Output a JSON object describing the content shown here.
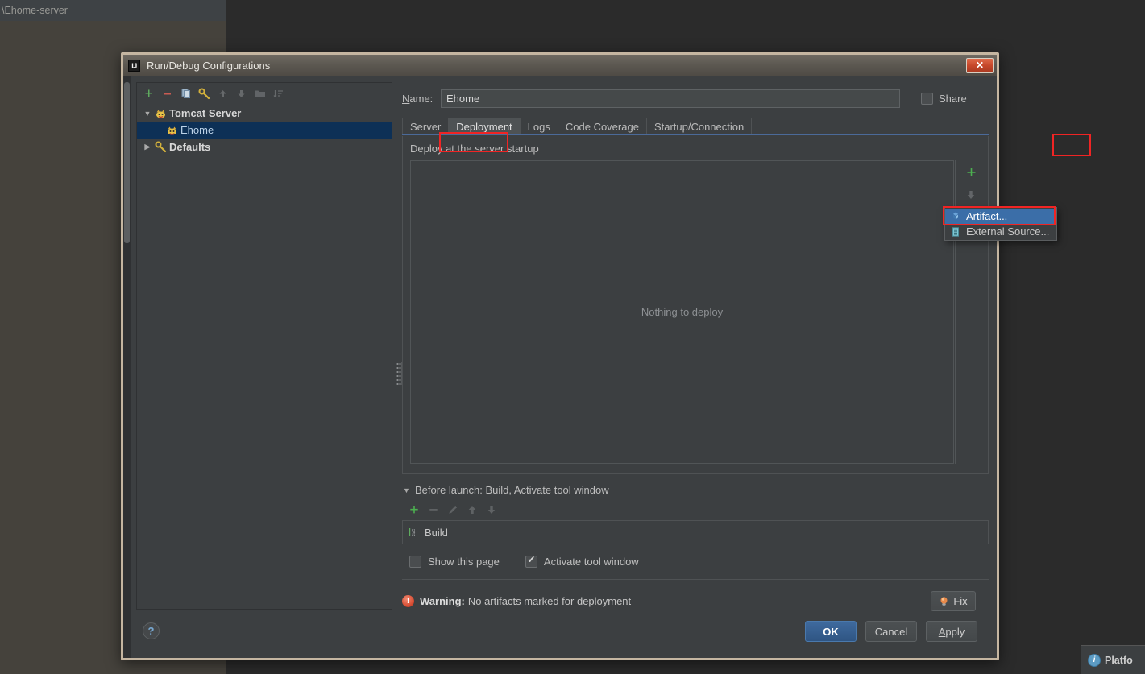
{
  "background": {
    "editor_tab_label": "\\Ehome-server",
    "notification_label": "Platfo"
  },
  "dialog": {
    "title": "Run/Debug Configurations",
    "close_label": "✕"
  },
  "left_pane": {
    "toolbar": [
      {
        "name": "add-configuration-button",
        "icon": "plus-icon",
        "enabled": true
      },
      {
        "name": "remove-configuration-button",
        "icon": "minus-icon",
        "enabled": true
      },
      {
        "name": "copy-configuration-button",
        "icon": "copy-icon",
        "enabled": true
      },
      {
        "name": "edit-templates-button",
        "icon": "wrench-icon",
        "enabled": true
      },
      {
        "name": "move-up-button",
        "icon": "arrow-up-icon",
        "enabled": false
      },
      {
        "name": "move-down-button",
        "icon": "arrow-down-icon",
        "enabled": false
      },
      {
        "name": "create-folder-button",
        "icon": "folder-icon",
        "enabled": false
      },
      {
        "name": "sort-button",
        "icon": "sort-icon",
        "enabled": false
      }
    ],
    "tree": [
      {
        "label": "Tomcat Server",
        "icon": "tomcat-icon",
        "expanded": true,
        "level": 0,
        "selected": false,
        "bold": true
      },
      {
        "label": "Ehome",
        "icon": "tomcat-icon",
        "expanded": null,
        "level": 1,
        "selected": true,
        "bold": false
      },
      {
        "label": "Defaults",
        "icon": "wrench-icon",
        "expanded": false,
        "level": 0,
        "selected": false,
        "bold": true
      }
    ]
  },
  "right_pane": {
    "name_label": "Name:",
    "name_value": "Ehome",
    "share_label": "Share",
    "share_checked": false,
    "tabs": [
      {
        "label": "Server",
        "active": false
      },
      {
        "label": "Deployment",
        "active": true,
        "highlighted": true
      },
      {
        "label": "Logs",
        "active": false
      },
      {
        "label": "Code Coverage",
        "active": false
      },
      {
        "label": "Startup/Connection",
        "active": false
      }
    ],
    "deployment": {
      "section_title": "Deploy at the server startup",
      "empty_text": "Nothing to deploy",
      "toolbar": [
        {
          "name": "add-deployment-button",
          "icon": "plus-icon",
          "enabled": true,
          "highlighted": true
        },
        {
          "name": "move-down-button",
          "icon": "arrow-down-icon",
          "enabled": false
        },
        {
          "name": "edit-deployment-button",
          "icon": "pencil-icon",
          "enabled": false
        }
      ],
      "popup_menu": [
        {
          "label": "Artifact...",
          "icon": "artifact-icon",
          "selected": true,
          "highlighted": true
        },
        {
          "label": "External Source...",
          "icon": "external-source-icon",
          "selected": false,
          "highlighted": false
        }
      ]
    },
    "before_launch": {
      "header": "Before launch: Build, Activate tool window",
      "toolbar": [
        {
          "name": "add-task-button",
          "icon": "plus-icon",
          "enabled": true
        },
        {
          "name": "remove-task-button",
          "icon": "minus-icon",
          "enabled": false
        },
        {
          "name": "edit-task-button",
          "icon": "pencil-icon",
          "enabled": false
        },
        {
          "name": "move-task-up-button",
          "icon": "arrow-up-icon",
          "enabled": false
        },
        {
          "name": "move-task-down-button",
          "icon": "arrow-down-icon",
          "enabled": false
        }
      ],
      "tasks": [
        {
          "label": "Build",
          "icon": "build-icon"
        }
      ],
      "show_page_label": "Show this page",
      "show_page_checked": false,
      "activate_tool_window_label": "Activate tool window",
      "activate_tool_window_checked": true
    },
    "warning": {
      "label": "Warning:",
      "text": "No artifacts marked for deployment",
      "icon": "warning-icon",
      "fix_label": "Fix"
    }
  },
  "footer": {
    "help_label": "?",
    "buttons": [
      {
        "label": "OK",
        "style": "default"
      },
      {
        "label": "Cancel",
        "style": "normal"
      },
      {
        "label": "Apply",
        "style": "normal"
      }
    ]
  },
  "colors": {
    "dialog_bg": "#3c3f41",
    "selection_blue": "#0d3056",
    "menu_selection": "#3b6ea8",
    "accent_red": "#f02424",
    "default_button": "#3f6a9e"
  }
}
